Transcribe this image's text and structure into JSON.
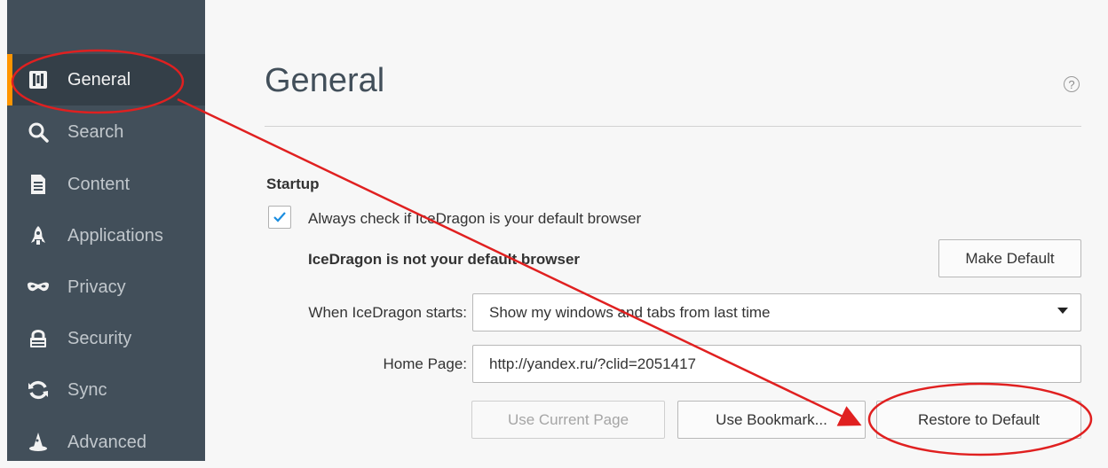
{
  "sidebar": {
    "items": [
      {
        "label": "General",
        "icon": "general-icon",
        "active": true
      },
      {
        "label": "Search",
        "icon": "search-icon"
      },
      {
        "label": "Content",
        "icon": "document-icon"
      },
      {
        "label": "Applications",
        "icon": "rocket-icon"
      },
      {
        "label": "Privacy",
        "icon": "mask-icon"
      },
      {
        "label": "Security",
        "icon": "lock-icon"
      },
      {
        "label": "Sync",
        "icon": "sync-icon"
      },
      {
        "label": "Advanced",
        "icon": "wizard-hat-icon"
      }
    ]
  },
  "main": {
    "title": "General",
    "help_icon": "?",
    "startup": {
      "section_title": "Startup",
      "default_check_label": "Always check if IceDragon is your default browser",
      "default_checked": true,
      "not_default_text": "IceDragon is not your default browser",
      "make_default_label": "Make Default"
    },
    "when_starts": {
      "label": "When IceDragon starts:",
      "value": "Show my windows and tabs from last time"
    },
    "home_page": {
      "label": "Home Page:",
      "value": "http://yandex.ru/?clid=2051417"
    },
    "buttons": {
      "use_current": "Use Current Page",
      "use_bookmark": "Use Bookmark...",
      "restore_default": "Restore to Default"
    }
  },
  "annotation": {
    "color": "#e02020"
  },
  "colors": {
    "sidebar_bg": "#424f5a",
    "active_bg": "#343f48",
    "accent": "#ff9500"
  }
}
